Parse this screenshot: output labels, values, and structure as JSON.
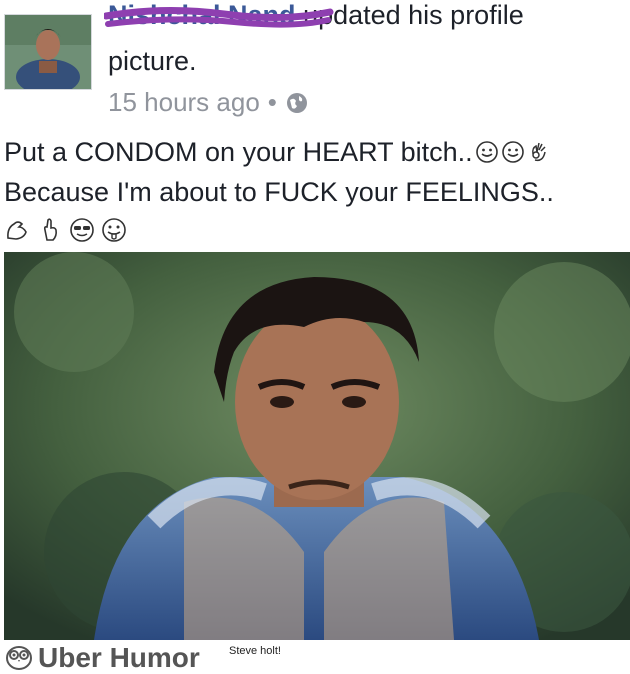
{
  "post": {
    "author": "Nishchal Nand",
    "action": "updated his profile",
    "action_cont": "picture.",
    "time": "15 hours ago",
    "separator": "•",
    "privacy_icon": "globe-icon",
    "caption_line1": "Put a CONDOM on your HEART bitch..",
    "caption_line2": "Because I'm about to FUCK your FEELINGS.."
  },
  "footer": {
    "brand": "Uber Humor",
    "credit": "Steve holt!"
  },
  "colors": {
    "author": "#3b5998",
    "scribble": "#8e3fb0",
    "meta": "#90949c"
  }
}
